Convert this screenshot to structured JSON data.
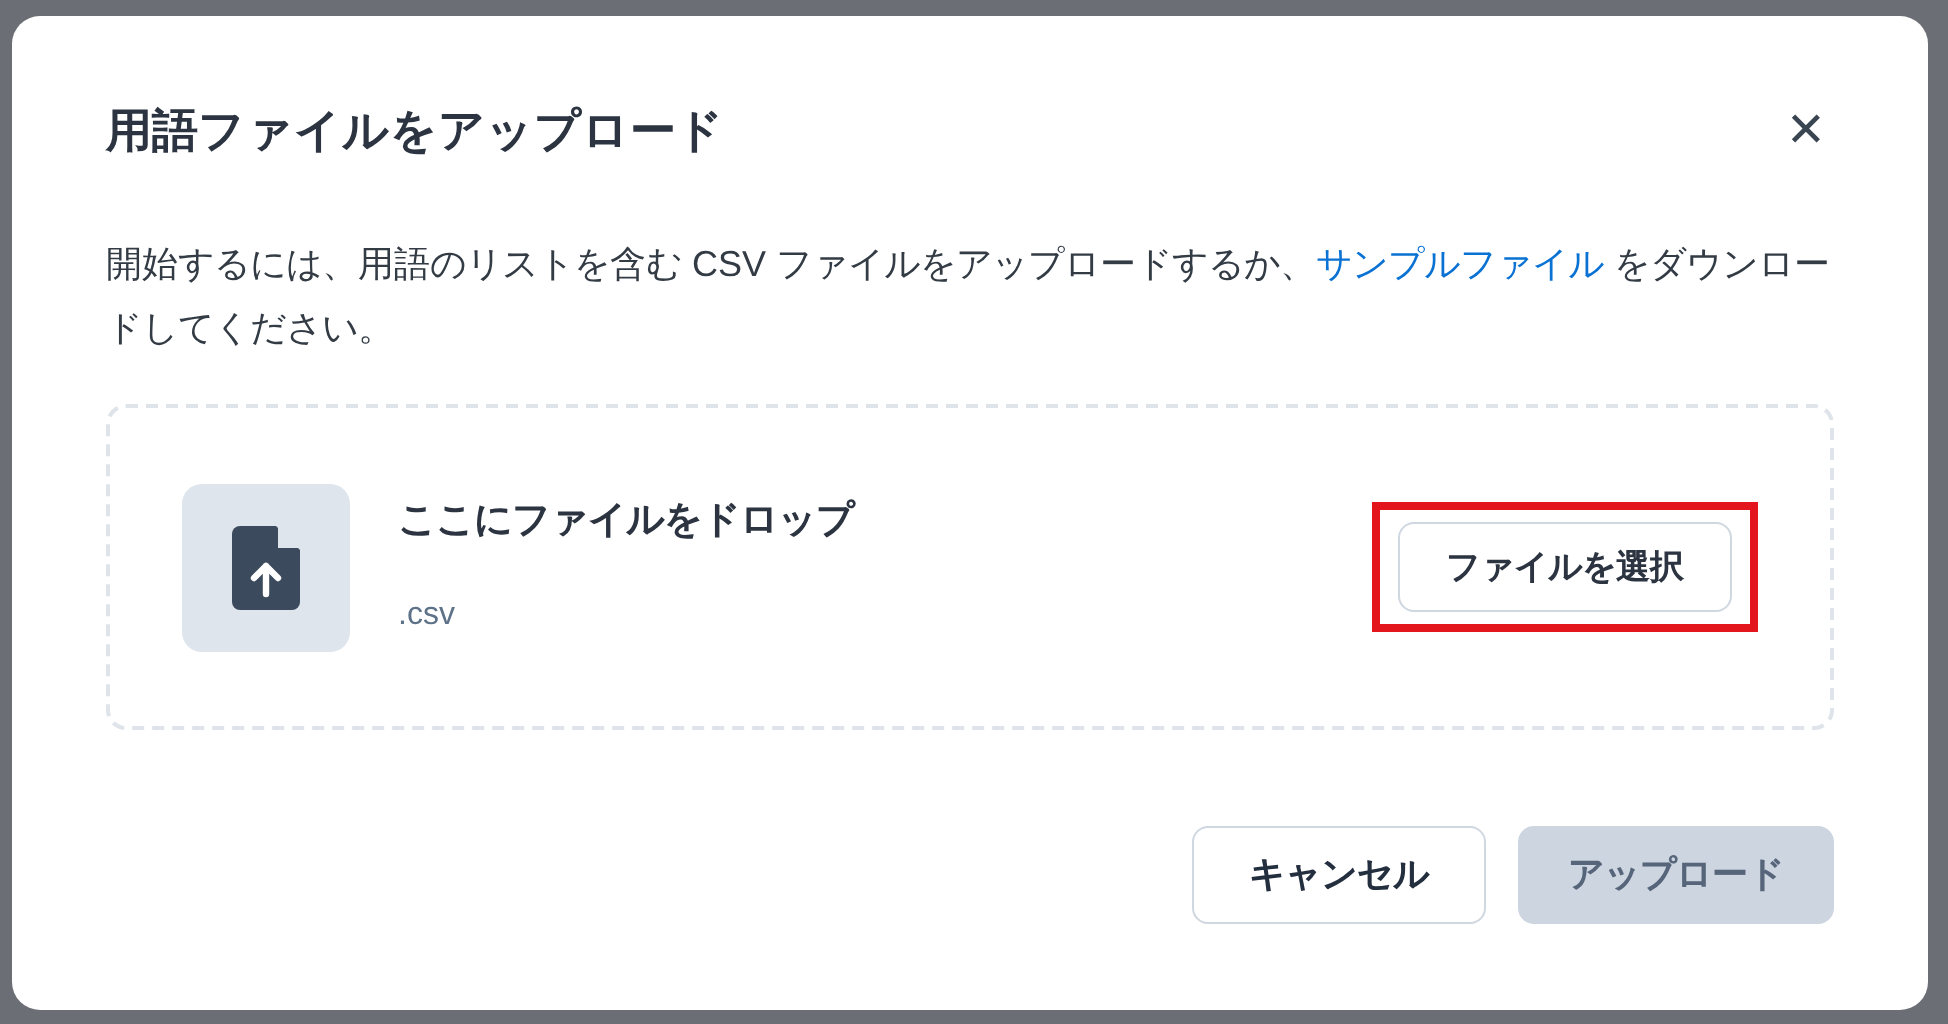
{
  "dialog": {
    "title": "用語ファイルをアップロード",
    "close": "✕",
    "description": {
      "before": "開始するには、用語のリストを含む CSV ファイルをアップロードするか、",
      "link": "サンプルファイル",
      "after": " をダウンロードしてください。"
    },
    "dropzone": {
      "heading": "ここにファイルをドロップ",
      "formats": ".csv",
      "button": {
        "label": "ファイルを選択",
        "highlighted": true
      }
    },
    "buttons": [
      {
        "label": "キャンセル",
        "kind": "secondary",
        "disabled": false
      },
      {
        "label": "アップロード",
        "kind": "primary",
        "disabled": true
      }
    ]
  }
}
